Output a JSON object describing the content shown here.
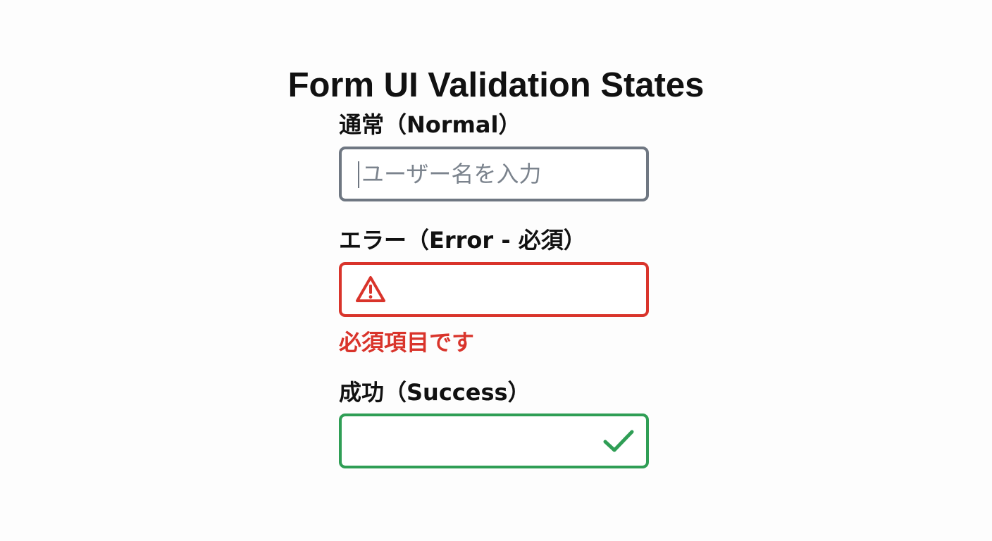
{
  "page": {
    "title": "Form UI Validation States"
  },
  "fields": {
    "normal": {
      "label": "通常（Normal）",
      "placeholder": "ユーザー名を入力",
      "value": ""
    },
    "error": {
      "label": "エラー（Error - 必須）",
      "value": "",
      "icon": "warning-triangle-icon",
      "message": "必須項目です"
    },
    "success": {
      "label": "成功（Success）",
      "value": "",
      "icon": "checkmark-icon"
    }
  },
  "colors": {
    "normal_border": "#6f7782",
    "error": "#d9342b",
    "success": "#2f9e55",
    "text": "#111111",
    "placeholder": "#7b838d"
  }
}
